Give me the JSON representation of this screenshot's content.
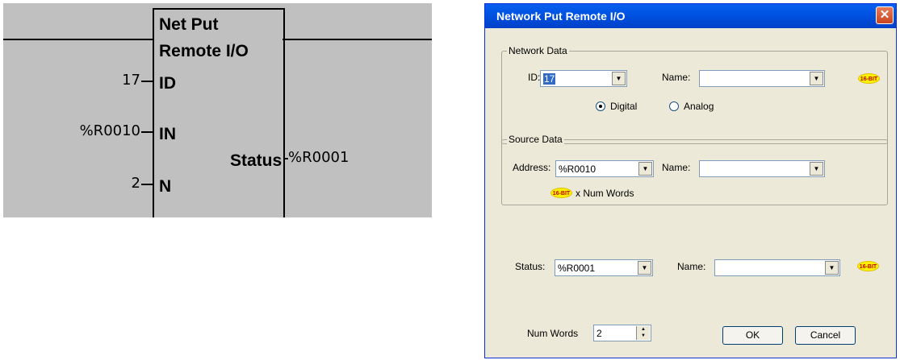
{
  "ladder": {
    "block_title_line1": "Net Put",
    "block_title_line2": "Remote I/O",
    "pins": {
      "id": "ID",
      "in": "IN",
      "n": "N",
      "status": "Status"
    },
    "values": {
      "id": "17",
      "in": "%R0010",
      "n": "2",
      "status": "%R0001"
    }
  },
  "dialog": {
    "title": "Network Put Remote I/O",
    "close_glyph": "✕",
    "badge_text": "16-BIT",
    "network_data": {
      "legend": "Network Data",
      "id_label": "ID:",
      "id_value": "17",
      "name_label": "Name:",
      "name_value": "",
      "digital_label": "Digital",
      "analog_label": "Analog",
      "selected": "Digital"
    },
    "source_data": {
      "legend": "Source Data",
      "address_label": "Address:",
      "address_value": "%R0010",
      "name_label": "Name:",
      "name_value": "",
      "num_words_note": "x Num Words"
    },
    "status": {
      "label": "Status:",
      "value": "%R0001",
      "name_label": "Name:",
      "name_value": ""
    },
    "num_words": {
      "label": "Num Words",
      "value": "2"
    },
    "ok_label": "OK",
    "cancel_label": "Cancel"
  }
}
